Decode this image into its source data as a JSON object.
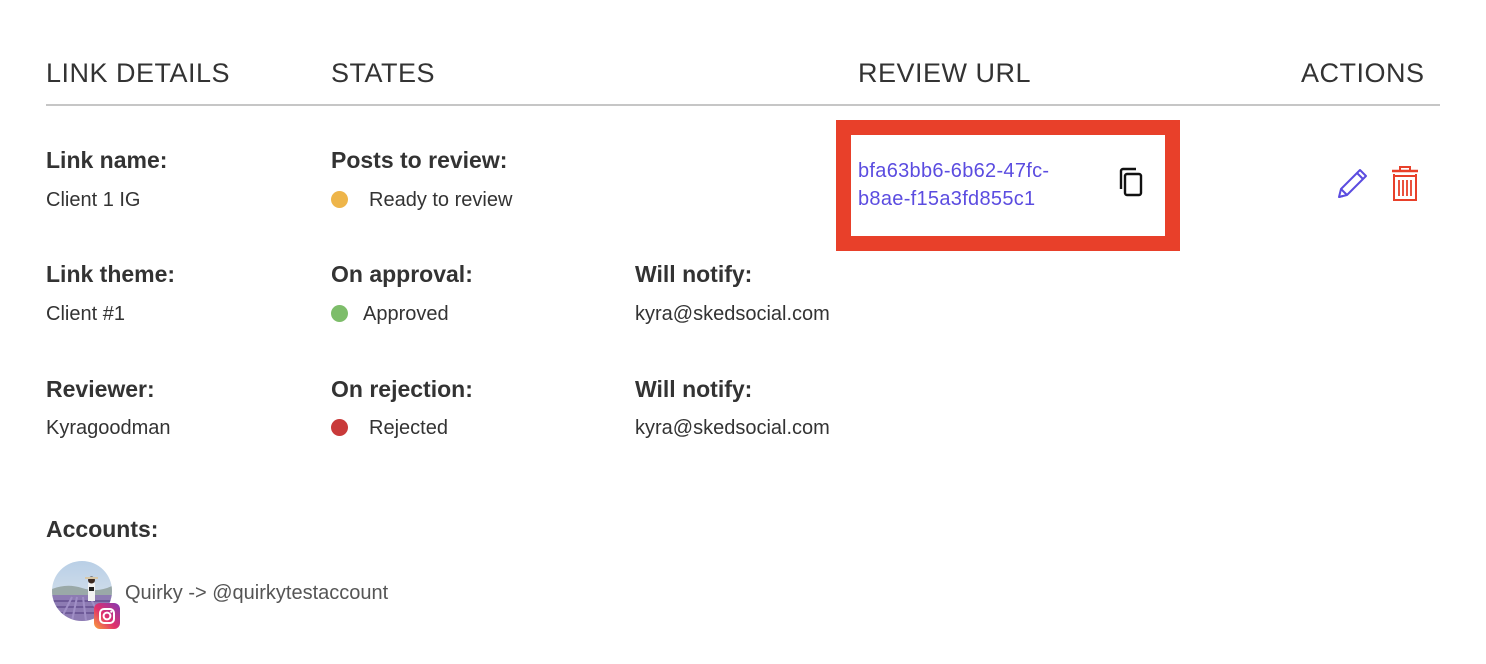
{
  "columns": {
    "link_details": "LINK DETAILS",
    "states": "STATES",
    "review_url": "REVIEW URL",
    "actions": "ACTIONS"
  },
  "details": {
    "link_name_label": "Link name:",
    "link_name_value": "Client 1 IG",
    "link_theme_label": "Link theme:",
    "link_theme_value": "Client #1",
    "reviewer_label": "Reviewer:",
    "reviewer_value": "Kyragoodman"
  },
  "states": {
    "posts_to_review_label": "Posts to review:",
    "posts_to_review_state": "Ready to review",
    "posts_to_review_color": "#eeb54a",
    "on_approval_label": "On approval:",
    "on_approval_state": "Approved",
    "on_approval_color": "#7dbd6a",
    "on_rejection_label": "On rejection:",
    "on_rejection_state": "Rejected",
    "on_rejection_color": "#c93a3a"
  },
  "notify": {
    "approval_label": "Will notify:",
    "approval_email": "kyra@skedsocial.com",
    "rejection_label": "Will notify:",
    "rejection_email": "kyra@skedsocial.com"
  },
  "review_url": {
    "line1": "bfa63bb6-6b62-47fc-",
    "line2": "b8ae-f15a3fd855c1",
    "copy_icon": "copy-icon"
  },
  "actions": {
    "edit_icon": "pencil-icon",
    "delete_icon": "trash-icon",
    "edit_color": "#5b4ce0",
    "delete_color": "#e8402a"
  },
  "accounts": {
    "label": "Accounts:",
    "items": [
      {
        "text": "Quirky -> @quirkytestaccount",
        "platform_icon": "instagram-icon"
      }
    ]
  }
}
